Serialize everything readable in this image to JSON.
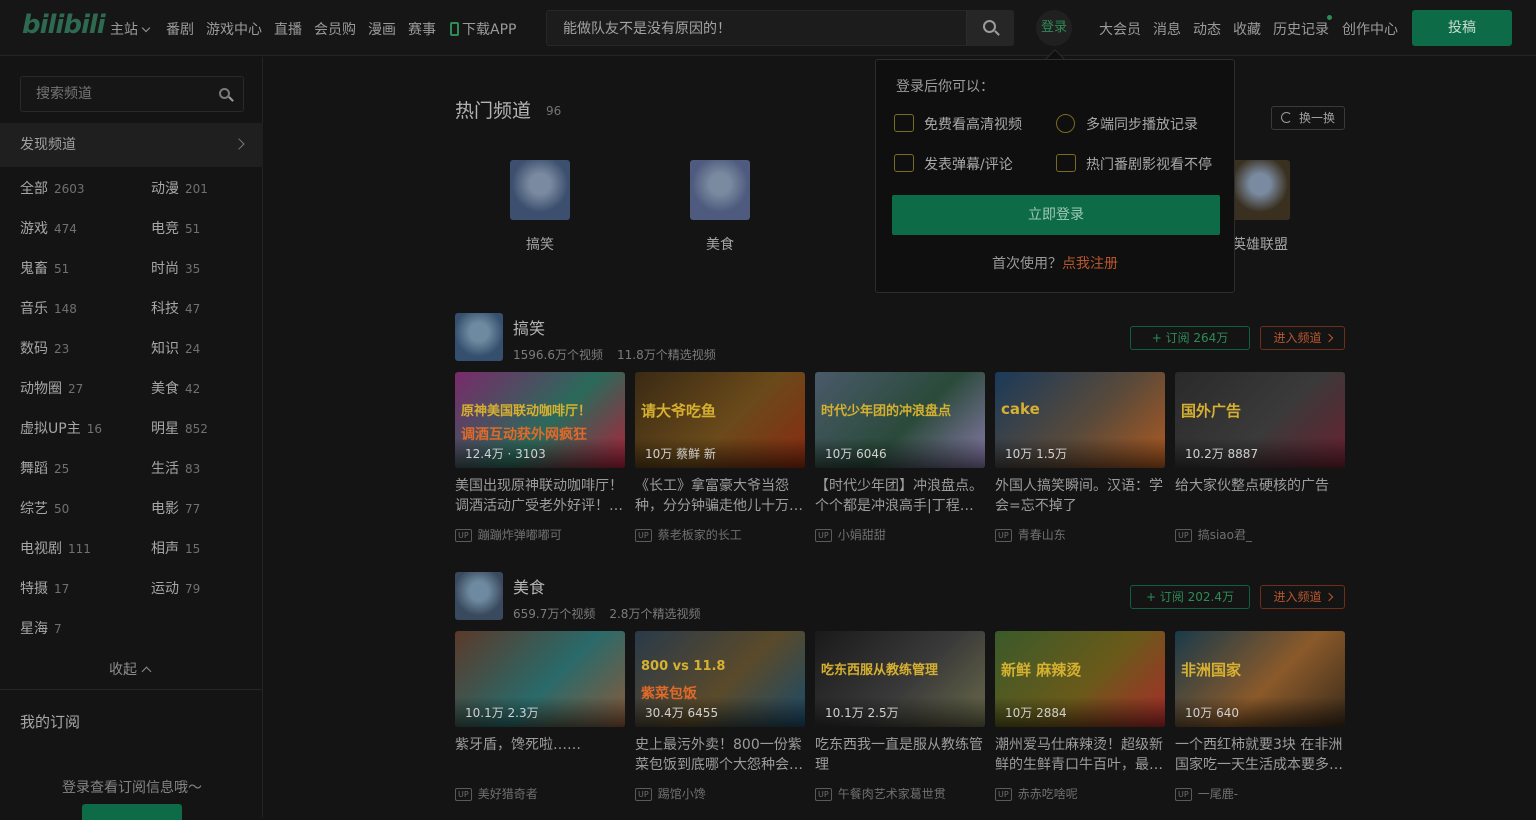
{
  "header": {
    "logo": "bilibili",
    "nav": [
      "主站",
      "番剧",
      "游戏中心",
      "直播",
      "会员购",
      "漫画",
      "赛事",
      "下载APP"
    ],
    "search_value": "能做队友不是没有原因的！",
    "login": "登录",
    "right": [
      "大会员",
      "消息",
      "动态",
      "收藏",
      "历史记录",
      "创作中心"
    ],
    "upload": "投稿"
  },
  "sidebar": {
    "search_placeholder": "搜索频道",
    "discover": "发现频道",
    "categories": [
      {
        "name": "全部",
        "count": "2603"
      },
      {
        "name": "动漫",
        "count": "201"
      },
      {
        "name": "游戏",
        "count": "474"
      },
      {
        "name": "电竞",
        "count": "51"
      },
      {
        "name": "鬼畜",
        "count": "51"
      },
      {
        "name": "时尚",
        "count": "35"
      },
      {
        "name": "音乐",
        "count": "148"
      },
      {
        "name": "科技",
        "count": "47"
      },
      {
        "name": "数码",
        "count": "23"
      },
      {
        "name": "知识",
        "count": "24"
      },
      {
        "name": "动物圈",
        "count": "27"
      },
      {
        "name": "美食",
        "count": "42"
      },
      {
        "name": "虚拟UP主",
        "count": "16"
      },
      {
        "name": "明星",
        "count": "852"
      },
      {
        "name": "舞蹈",
        "count": "25"
      },
      {
        "name": "生活",
        "count": "83"
      },
      {
        "name": "综艺",
        "count": "50"
      },
      {
        "name": "电影",
        "count": "77"
      },
      {
        "name": "电视剧",
        "count": "111"
      },
      {
        "name": "相声",
        "count": "15"
      },
      {
        "name": "特摄",
        "count": "17"
      },
      {
        "name": "运动",
        "count": "79"
      },
      {
        "name": "星海",
        "count": "7"
      }
    ],
    "collapse": "收起",
    "my_subs": "我的订阅",
    "login_hint": "登录查看订阅信息哦～"
  },
  "hot": {
    "title": "热门频道",
    "count": "96",
    "refresh": "换一换",
    "channels": [
      {
        "name": "搞笑",
        "color": "#3c4f6e"
      },
      {
        "name": "美食",
        "color": "#4e5a7e"
      },
      {
        "name": "英雄联盟",
        "color": "#3a3020"
      }
    ]
  },
  "sections": [
    {
      "name": "搞笑",
      "videos_count": "1596.6万个视频",
      "featured_count": "11.8万个精选视频",
      "subscribe": "+ 订阅 264万",
      "enter": "进入频道",
      "avatar_color": "#34506e",
      "videos": [
        {
          "title": "美国出现原神联动咖啡厅！调酒活动广受老外好评！…",
          "up": "蹦蹦炸弹嘟嘟可",
          "stats": "12.4万 · 3103",
          "caption": "原神美国联动咖啡厅！",
          "caption2": "调酒互动获外网疯狂",
          "colors": [
            "#7a2a6a",
            "#2a6a5a",
            "#b0203a"
          ]
        },
        {
          "title": "《长工》拿富豪大爷当怨种，分分钟骗走他儿十万…",
          "up": "蔡老板家的长工",
          "stats": "10万  蔡鲜  新",
          "caption": "请大爷吃鱼",
          "caption2": "",
          "colors": [
            "#3a2a14",
            "#6a4a1a",
            "#8a2a10"
          ]
        },
        {
          "title": "【时代少年团】冲浪盘点。个个都是冲浪高手|丁程…",
          "up": "小娟甜甜",
          "stats": "10万   6046",
          "caption": "时代少年团的冲浪盘点",
          "caption2": "",
          "colors": [
            "#4a5a6a",
            "#2a4a3a",
            "#8a7aaa"
          ]
        },
        {
          "title": "外国人搞笑瞬间。汉语：学会=忘不掉了",
          "up": "青春山东",
          "stats": "10万   1.5万",
          "caption": "cake",
          "caption2": "",
          "colors": [
            "#1a3a5a",
            "#5a4a3a",
            "#b05a20"
          ]
        },
        {
          "title": "给大家伙整点硬核的广告",
          "up": "搞siao君_",
          "stats": "10.2万   8887",
          "caption": "国外广告",
          "caption2": "",
          "colors": [
            "#2a2a2a",
            "#3a3a3a",
            "#6a2030"
          ]
        }
      ]
    },
    {
      "name": "美食",
      "videos_count": "659.7万个视频",
      "featured_count": "2.8万个精选视频",
      "subscribe": "+ 订阅 202.4万",
      "enter": "进入频道",
      "avatar_color": "#3a4a5e",
      "videos": [
        {
          "title": "紫牙盾，馋死啦……",
          "up": "美好猎奇者",
          "stats": "10.1万   2.3万",
          "caption": "",
          "caption2": "",
          "colors": [
            "#5a3a2a",
            "#2a6a6a",
            "#8a5a3a"
          ]
        },
        {
          "title": "史上最污外卖！800一份紫菜包饭到底哪个大怨种会…",
          "up": "踢馆小馋",
          "stats": "30.4万   6455",
          "caption": "800 vs 11.8",
          "caption2": "紫菜包饭",
          "colors": [
            "#2a3a4a",
            "#5a4a2a",
            "#1a4a6a"
          ]
        },
        {
          "title": "吃东西我一直是服从教练管理",
          "up": "午餐肉艺术家葛世贯",
          "stats": "10.1万   2.5万",
          "caption": "吃东西服从教练管理",
          "caption2": "",
          "colors": [
            "#1a1a1a",
            "#3a3a3a",
            "#6a6a4a"
          ]
        },
        {
          "title": "潮州爱马仕麻辣烫！超级新鲜的生鲜青口牛百叶，最…",
          "up": "赤赤吃啥呢",
          "stats": "10万   2884",
          "caption": "新鲜  麻辣烫",
          "caption2": "",
          "colors": [
            "#3a5a2a",
            "#6a5a1a",
            "#aa2a2a"
          ]
        },
        {
          "title": "一个西红柿就要3块 在非洲国家吃一天生活成本要多…",
          "up": "一尾鹿-",
          "stats": "10万   640",
          "caption": "非洲国家",
          "caption2": "",
          "colors": [
            "#1a3a4a",
            "#8a5a2a",
            "#3a2a1a"
          ]
        }
      ]
    }
  ],
  "login_popup": {
    "heading": "登录后你可以：",
    "features": [
      "免费看高清视频",
      "多端同步播放记录",
      "发表弹幕/评论",
      "热门番剧影视看不停"
    ],
    "button": "立即登录",
    "footer": "首次使用？",
    "register": "点我注册"
  }
}
